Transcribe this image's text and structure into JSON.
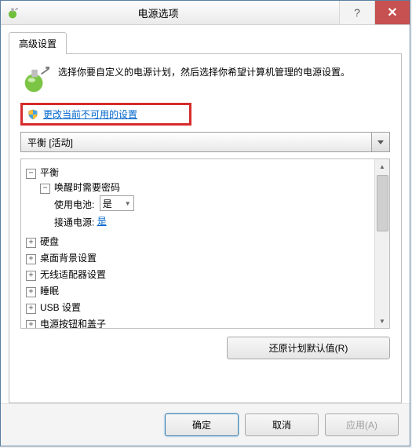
{
  "titlebar": {
    "title": "电源选项",
    "help": "?",
    "close": "✕"
  },
  "tab": {
    "label": "高级设置"
  },
  "intro": "选择你要自定义的电源计划，然后选择你希望计算机管理的电源设置。",
  "change_link": "更改当前不可用的设置",
  "plan_select": "平衡 [活动]",
  "tree": {
    "root": {
      "label": "平衡",
      "children": {
        "wakepw": {
          "label": "唤醒时需要密码",
          "battery": {
            "label": "使用电池:",
            "value": "是"
          },
          "plugged": {
            "label": "接通电源:",
            "value": "是"
          }
        }
      }
    },
    "items": [
      "硬盘",
      "桌面背景设置",
      "无线适配器设置",
      "睡眠",
      "USB 设置",
      "电源按钮和盖子"
    ]
  },
  "restore": "还原计划默认值(R)",
  "footer": {
    "ok": "确定",
    "cancel": "取消",
    "apply": "应用(A)"
  }
}
